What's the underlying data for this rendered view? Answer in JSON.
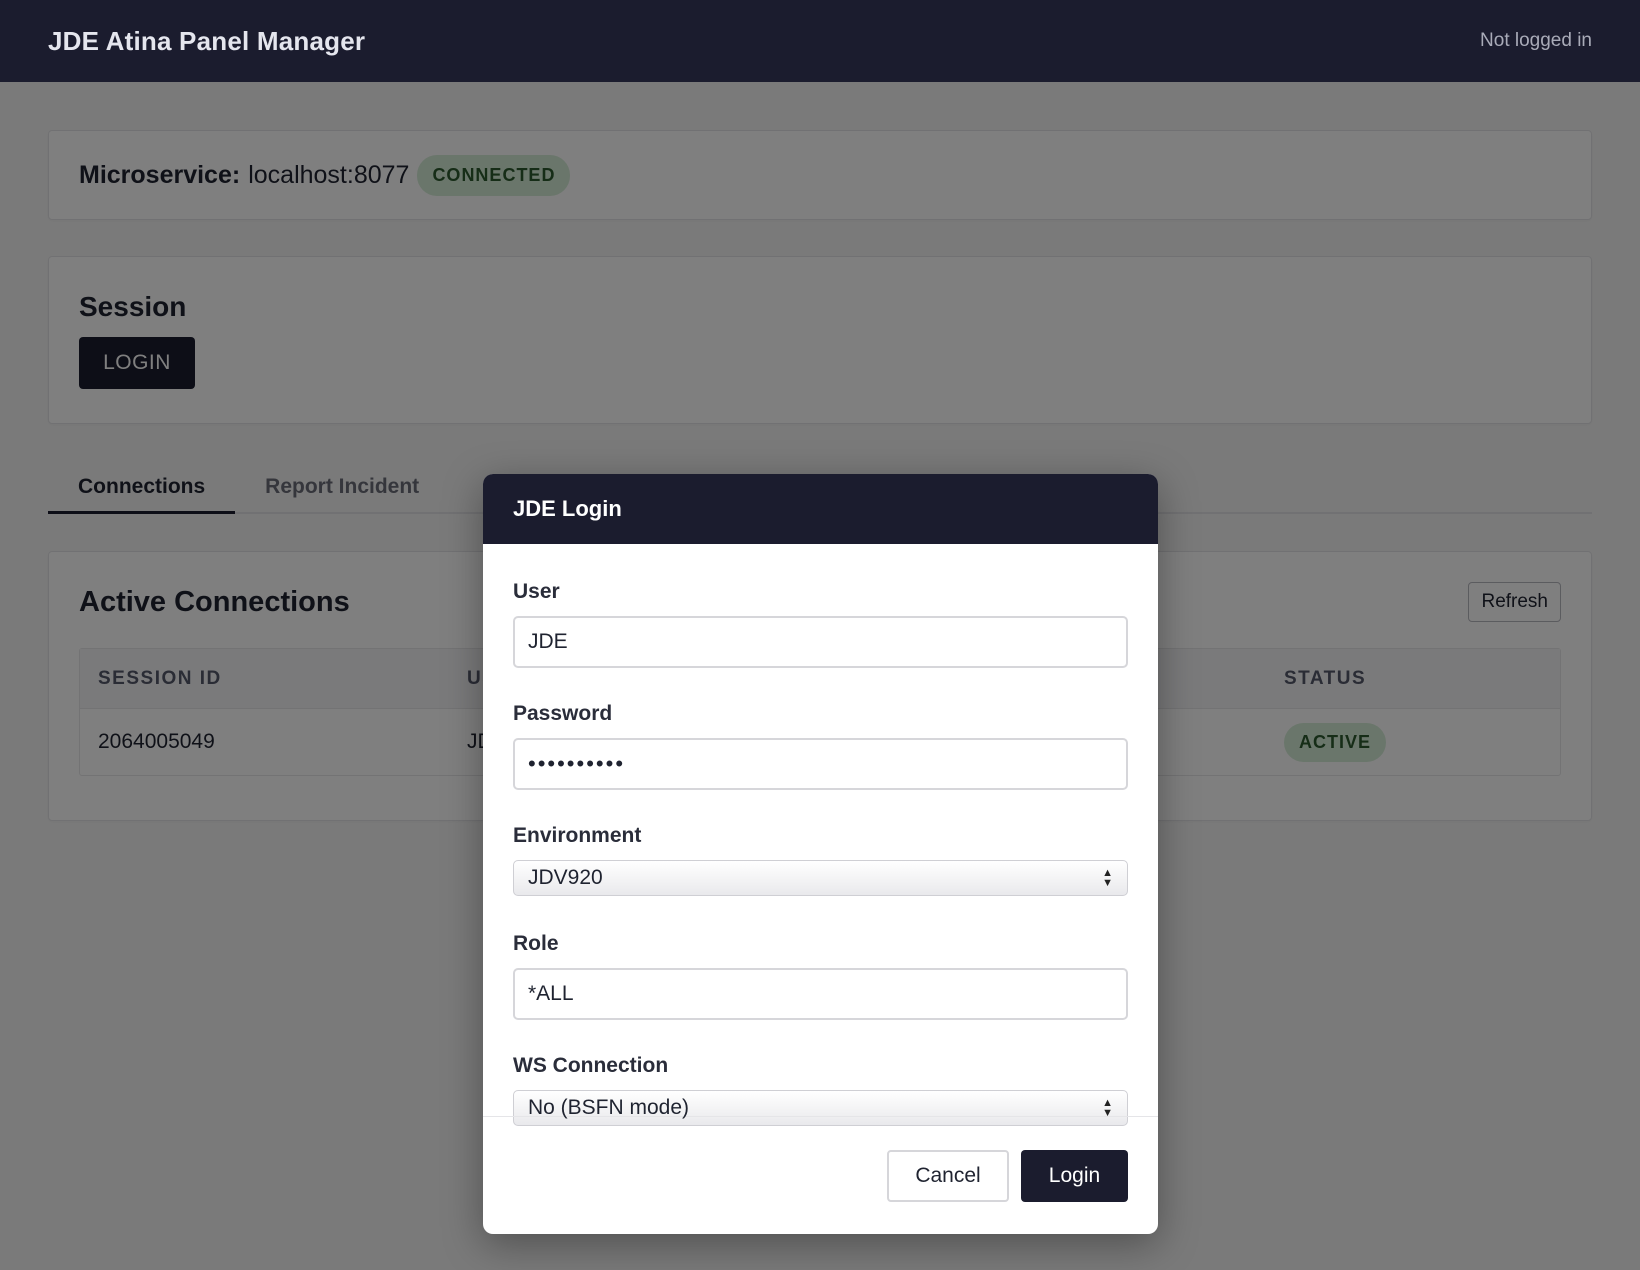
{
  "header": {
    "title": "JDE Atina Panel Manager",
    "login_status": "Not logged in"
  },
  "microservice": {
    "label": "Microservice:",
    "host": "localhost:8077",
    "status": "CONNECTED"
  },
  "session": {
    "title": "Session",
    "login_button": "LOGIN"
  },
  "tabs": [
    {
      "label": "Connections",
      "active": true
    },
    {
      "label": "Report Incident",
      "active": false
    }
  ],
  "connections": {
    "title": "Active Connections",
    "refresh_button": "Refresh",
    "columns": [
      "SESSION ID",
      "US",
      "STATUS"
    ],
    "rows": [
      {
        "session_id": "2064005049",
        "user": "JD",
        "status": "ACTIVE"
      }
    ]
  },
  "modal": {
    "title": "JDE Login",
    "user": {
      "label": "User",
      "value": "JDE"
    },
    "password": {
      "label": "Password",
      "value": "••••••••••"
    },
    "environment": {
      "label": "Environment",
      "value": "JDV920"
    },
    "role": {
      "label": "Role",
      "value": "*ALL"
    },
    "ws_connection": {
      "label": "WS Connection",
      "value": "No (BSFN mode)"
    },
    "cancel_button": "Cancel",
    "login_button": "Login"
  },
  "colors": {
    "navbar": "#1b1c2e",
    "badge_bg": "#d5ecd6",
    "badge_text": "#2d5a2f",
    "overlay": "rgba(0,0,0,0.5)"
  }
}
